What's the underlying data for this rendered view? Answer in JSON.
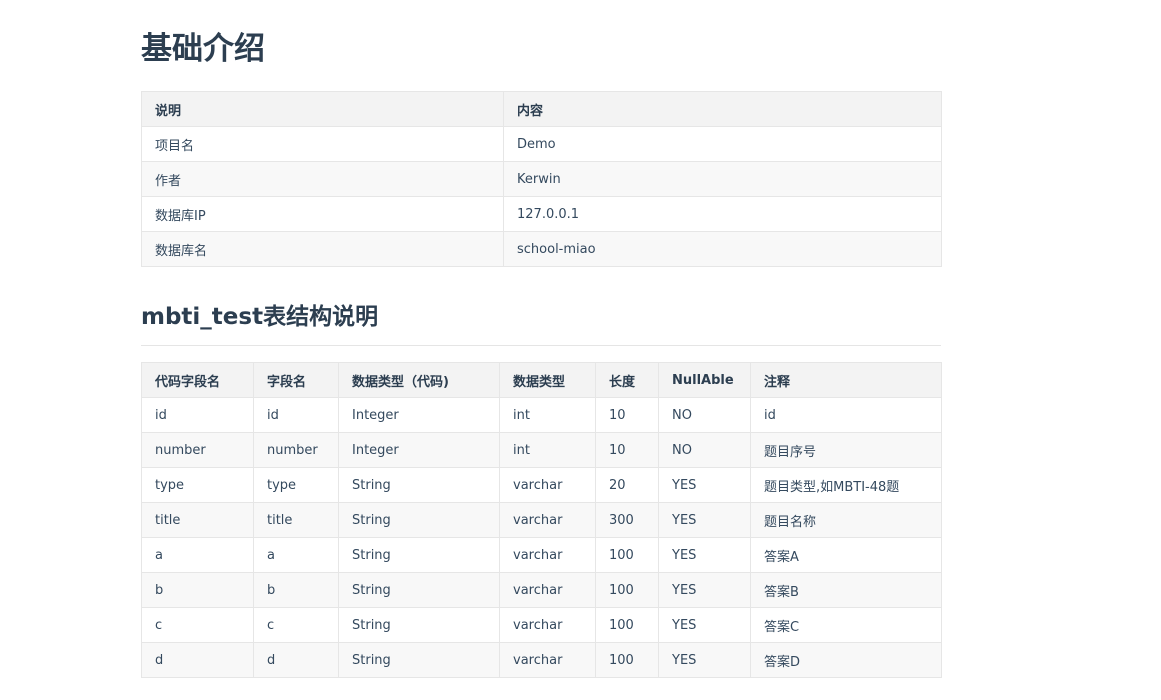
{
  "page_title": "基础介绍",
  "info_table": {
    "headers": [
      "说明",
      "内容"
    ],
    "rows": [
      [
        "项目名",
        "Demo"
      ],
      [
        "作者",
        "Kerwin"
      ],
      [
        "数据库IP",
        "127.0.0.1"
      ],
      [
        "数据库名",
        "school-miao"
      ]
    ]
  },
  "section_title": "mbti_test表结构说明",
  "schema_table": {
    "headers": [
      "代码字段名",
      "字段名",
      "数据类型（代码)",
      "数据类型",
      "长度",
      "NullAble",
      "注释"
    ],
    "rows": [
      [
        "id",
        "id",
        "Integer",
        "int",
        "10",
        "NO",
        "id"
      ],
      [
        "number",
        "number",
        "Integer",
        "int",
        "10",
        "NO",
        "题目序号"
      ],
      [
        "type",
        "type",
        "String",
        "varchar",
        "20",
        "YES",
        "题目类型,如MBTI-48题"
      ],
      [
        "title",
        "title",
        "String",
        "varchar",
        "300",
        "YES",
        "题目名称"
      ],
      [
        "a",
        "a",
        "String",
        "varchar",
        "100",
        "YES",
        "答案A"
      ],
      [
        "b",
        "b",
        "String",
        "varchar",
        "100",
        "YES",
        "答案B"
      ],
      [
        "c",
        "c",
        "String",
        "varchar",
        "100",
        "YES",
        "答案C"
      ],
      [
        "d",
        "d",
        "String",
        "varchar",
        "100",
        "YES",
        "答案D"
      ]
    ]
  }
}
